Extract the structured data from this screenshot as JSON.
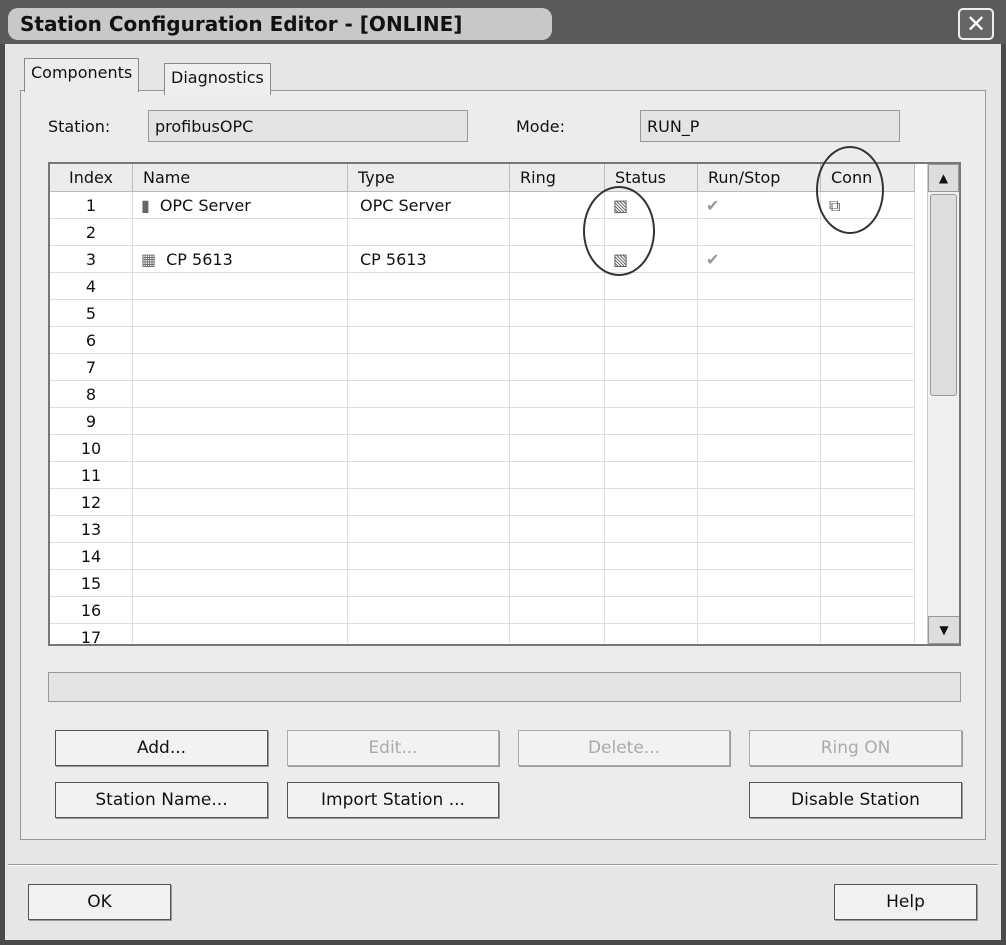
{
  "window": {
    "title": "Station Configuration Editor - [ONLINE]",
    "close": "✕"
  },
  "tabs": [
    {
      "label": "Components"
    },
    {
      "label": "Diagnostics"
    }
  ],
  "station": {
    "label": "Station:",
    "value": "profibusOPC"
  },
  "mode": {
    "label": "Mode:",
    "value": "RUN_P"
  },
  "grid": {
    "columns": [
      "Index",
      "Name",
      "Type",
      "Ring",
      "Status",
      "Run/Stop",
      "Conn"
    ],
    "rows": [
      {
        "index": "1",
        "name": "OPC Server",
        "type": "OPC Server",
        "icon": "server-icon",
        "status": "status-icon",
        "run": "check-icon",
        "conn": "connection-icon"
      },
      {
        "index": "2",
        "name": "",
        "type": ""
      },
      {
        "index": "3",
        "name": "CP 5613",
        "type": "CP 5613",
        "icon": "card-icon",
        "status": "status-icon",
        "run": "check-icon"
      },
      {
        "index": "4"
      },
      {
        "index": "5"
      },
      {
        "index": "6"
      },
      {
        "index": "7"
      },
      {
        "index": "8"
      },
      {
        "index": "9"
      },
      {
        "index": "10"
      },
      {
        "index": "11"
      },
      {
        "index": "12"
      },
      {
        "index": "13"
      },
      {
        "index": "14"
      },
      {
        "index": "15"
      },
      {
        "index": "16"
      },
      {
        "index": "17"
      }
    ]
  },
  "status_bar": "",
  "buttons": {
    "add": "Add...",
    "edit": "Edit...",
    "delete": "Delete...",
    "ring_on": "Ring ON",
    "station_name": "Station Name...",
    "import_station": "Import Station ...",
    "disable_station": "Disable Station",
    "ok": "OK",
    "help": "Help"
  }
}
